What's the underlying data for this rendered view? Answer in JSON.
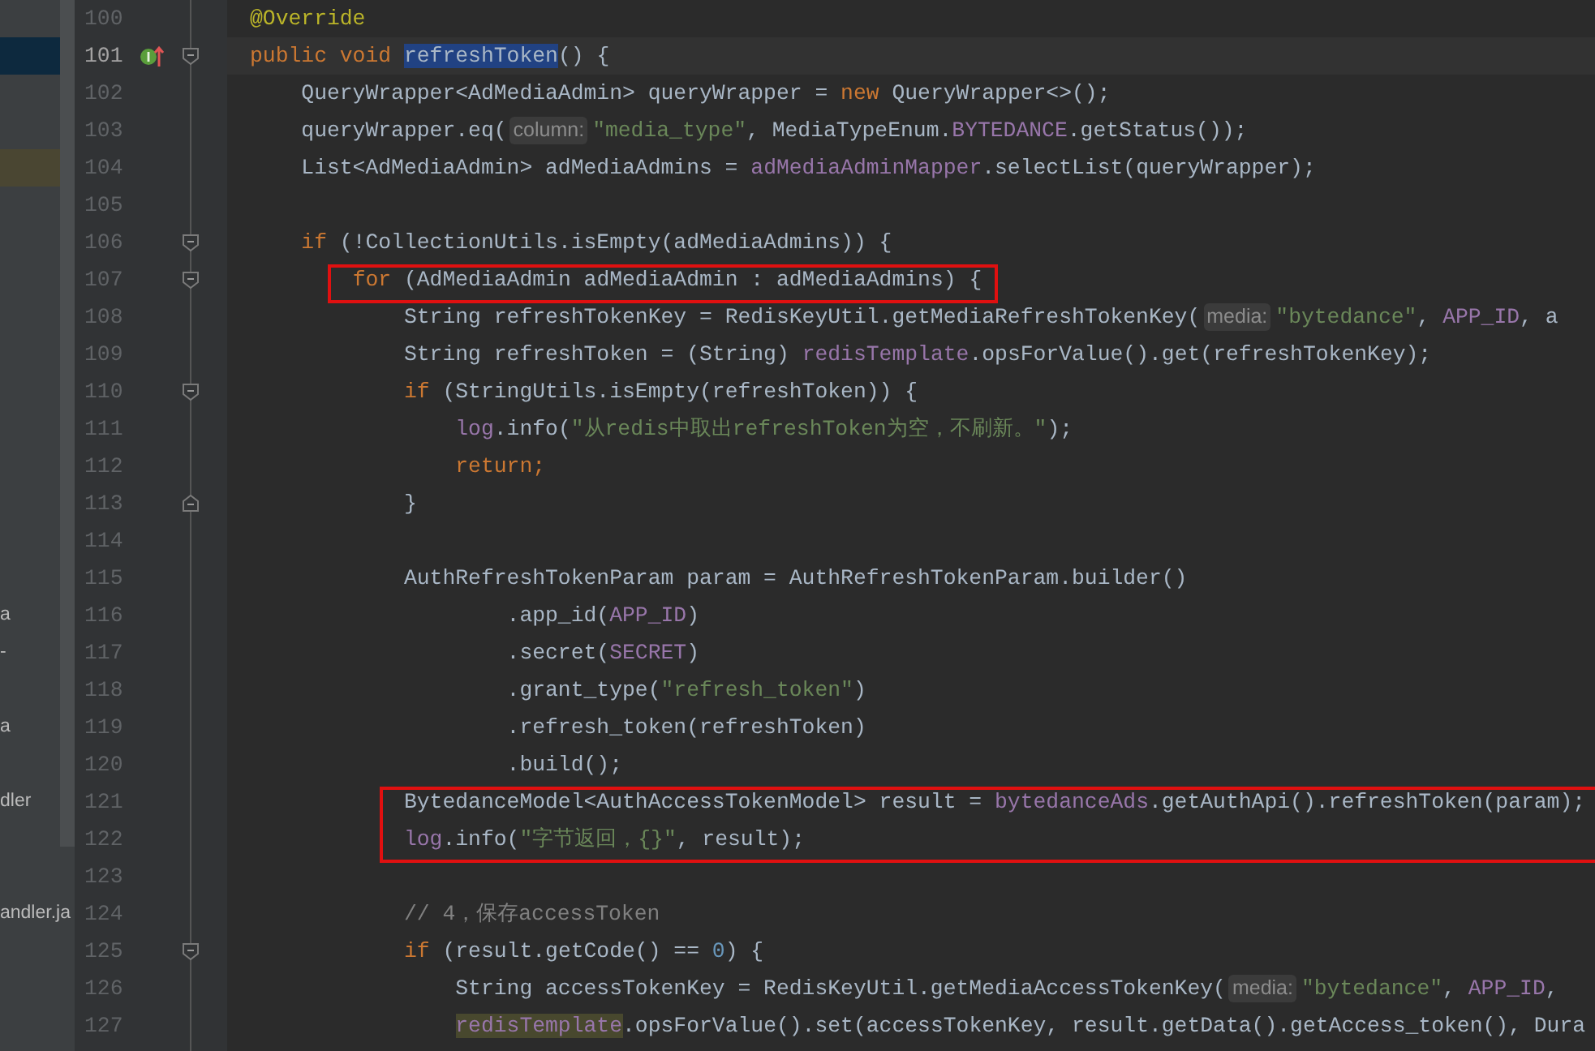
{
  "sidebar": {
    "rows": [
      {
        "selected": false
      },
      {
        "selected": true
      },
      {
        "selected": false
      },
      {
        "selected": false
      },
      {
        "selected": false,
        "highlighted": true
      },
      {
        "selected": false
      },
      {
        "selected": false
      },
      {
        "selected": false
      },
      {
        "selected": false
      },
      {
        "selected": false
      },
      {
        "selected": false
      },
      {
        "selected": false
      },
      {
        "selected": false
      },
      {
        "selected": false
      },
      {
        "selected": false
      },
      {
        "selected": false
      },
      {
        "selected": false,
        "text": "a"
      },
      {
        "selected": false,
        "text": "-"
      },
      {
        "selected": false
      },
      {
        "selected": false,
        "text": "a"
      },
      {
        "selected": false
      },
      {
        "selected": false,
        "text": "dler"
      },
      {
        "selected": false
      },
      {
        "selected": false
      },
      {
        "selected": false,
        "text": "andler.ja"
      }
    ]
  },
  "editor": {
    "lines": [
      {
        "number": "100",
        "boxed": false,
        "tokens": [
          {
            "kind": "annotation",
            "text": "@Override"
          }
        ]
      },
      {
        "number": "101",
        "current": true,
        "boxed": false,
        "fold_start": true,
        "override_marker": true,
        "tokens": [
          {
            "kind": "keyword",
            "text": "public void "
          },
          {
            "kind": "selection",
            "text": "refreshToken"
          },
          {
            "kind": "plain",
            "text": "() {"
          }
        ]
      },
      {
        "number": "102",
        "boxed": false,
        "tokens": [
          {
            "kind": "plain",
            "text": "    QueryWrapper<AdMediaAdmin> queryWrapper = "
          },
          {
            "kind": "keyword",
            "text": "new"
          },
          {
            "kind": "plain",
            "text": " QueryWrapper<>();"
          }
        ]
      },
      {
        "number": "103",
        "boxed": false,
        "tokens": [
          {
            "kind": "plain",
            "text": "    queryWrapper.eq("
          },
          {
            "kind": "hint",
            "text": "column:"
          },
          {
            "kind": "string",
            "text": "\"media_type\""
          },
          {
            "kind": "plain",
            "text": ", MediaTypeEnum."
          },
          {
            "kind": "field",
            "text": "BYTEDANCE"
          },
          {
            "kind": "plain",
            "text": ".getStatus());"
          }
        ]
      },
      {
        "number": "104",
        "boxed": false,
        "tokens": [
          {
            "kind": "plain",
            "text": "    List<AdMediaAdmin> adMediaAdmins = "
          },
          {
            "kind": "field",
            "text": "adMediaAdminMapper"
          },
          {
            "kind": "plain",
            "text": ".selectList(queryWrapper);"
          }
        ]
      },
      {
        "number": "105",
        "boxed": false
      },
      {
        "number": "106",
        "boxed": false,
        "fold_start": true,
        "tokens": [
          {
            "kind": "keyword",
            "text": "    if"
          },
          {
            "kind": "plain",
            "text": " (!CollectionUtils.isEmpty(adMediaAdmins)) {"
          }
        ]
      },
      {
        "number": "107",
        "boxed": true,
        "fold_start": true,
        "tokens": [
          {
            "kind": "keyword",
            "text": "        for"
          },
          {
            "kind": "plain",
            "text": " (AdMediaAdmin adMediaAdmin : adMediaAdmins) {"
          }
        ]
      },
      {
        "number": "108",
        "boxed": false,
        "tokens": [
          {
            "kind": "plain",
            "text": "            String refreshTokenKey = RedisKeyUtil.getMediaRefreshTokenKey("
          },
          {
            "kind": "hint",
            "text": "media:"
          },
          {
            "kind": "string",
            "text": "\"bytedance\""
          },
          {
            "kind": "plain",
            "text": ", "
          },
          {
            "kind": "field",
            "text": "APP_ID"
          },
          {
            "kind": "plain",
            "text": ", a"
          }
        ]
      },
      {
        "number": "109",
        "boxed": false,
        "tokens": [
          {
            "kind": "plain",
            "text": "            String refreshToken = (String) "
          },
          {
            "kind": "field",
            "text": "redisTemplate"
          },
          {
            "kind": "plain",
            "text": ".opsForValue().get(refreshTokenKey);"
          }
        ]
      },
      {
        "number": "110",
        "boxed": false,
        "fold_start": true,
        "tokens": [
          {
            "kind": "keyword",
            "text": "            if"
          },
          {
            "kind": "plain",
            "text": " (StringUtils.isEmpty(refreshToken)) {"
          }
        ]
      },
      {
        "number": "111",
        "boxed": false,
        "tokens": [
          {
            "kind": "field",
            "text": "                log"
          },
          {
            "kind": "plain",
            "text": ".info("
          },
          {
            "kind": "string",
            "text": "\"从redis中取出refreshToken为空，不刷新。\""
          },
          {
            "kind": "plain",
            "text": ");"
          }
        ]
      },
      {
        "number": "112",
        "boxed": false,
        "tokens": [
          {
            "kind": "keyword",
            "text": "                return;"
          }
        ]
      },
      {
        "number": "113",
        "boxed": false,
        "fold_end": true,
        "tokens": [
          {
            "kind": "plain",
            "text": "            }"
          }
        ]
      },
      {
        "number": "114",
        "boxed": false
      },
      {
        "number": "115",
        "boxed": false,
        "tokens": [
          {
            "kind": "plain",
            "text": "            AuthRefreshTokenParam param = AuthRefreshTokenParam.builder()"
          }
        ]
      },
      {
        "number": "116",
        "boxed": false,
        "tokens": [
          {
            "kind": "plain",
            "text": "                    .app_id("
          },
          {
            "kind": "field",
            "text": "APP_ID"
          },
          {
            "kind": "plain",
            "text": ")"
          }
        ]
      },
      {
        "number": "117",
        "boxed": false,
        "tokens": [
          {
            "kind": "plain",
            "text": "                    .secret("
          },
          {
            "kind": "field",
            "text": "SECRET"
          },
          {
            "kind": "plain",
            "text": ")"
          }
        ]
      },
      {
        "number": "118",
        "boxed": false,
        "tokens": [
          {
            "kind": "plain",
            "text": "                    .grant_type("
          },
          {
            "kind": "string",
            "text": "\"refresh_token\""
          },
          {
            "kind": "plain",
            "text": ")"
          }
        ]
      },
      {
        "number": "119",
        "boxed": false,
        "tokens": [
          {
            "kind": "plain",
            "text": "                    .refresh_token(refreshToken)"
          }
        ]
      },
      {
        "number": "120",
        "boxed": false,
        "tokens": [
          {
            "kind": "plain",
            "text": "                    .build();"
          }
        ]
      },
      {
        "number": "121",
        "boxed": true,
        "tokens": [
          {
            "kind": "plain",
            "text": "            BytedanceModel<AuthAccessTokenModel> result = "
          },
          {
            "kind": "field",
            "text": "bytedanceAds"
          },
          {
            "kind": "plain",
            "text": ".getAuthApi().refreshToken(param);"
          }
        ]
      },
      {
        "number": "122",
        "boxed": true,
        "tokens": [
          {
            "kind": "field",
            "text": "            log"
          },
          {
            "kind": "plain",
            "text": ".info("
          },
          {
            "kind": "string",
            "text": "\"字节返回，{}\""
          },
          {
            "kind": "plain",
            "text": ", result);"
          }
        ]
      },
      {
        "number": "123",
        "boxed": false
      },
      {
        "number": "124",
        "boxed": false,
        "tokens": [
          {
            "kind": "comment",
            "text": "            // 4，保存accessToken"
          }
        ]
      },
      {
        "number": "125",
        "boxed": false,
        "fold_start": true,
        "tokens": [
          {
            "kind": "keyword",
            "text": "            if"
          },
          {
            "kind": "plain",
            "text": " (result.getCode() == "
          },
          {
            "kind": "number",
            "text": "0"
          },
          {
            "kind": "plain",
            "text": ") {"
          }
        ]
      },
      {
        "number": "126",
        "boxed": false,
        "tokens": [
          {
            "kind": "plain",
            "text": "                String accessTokenKey = RedisKeyUtil.getMediaAccessTokenKey("
          },
          {
            "kind": "hint",
            "text": "media:"
          },
          {
            "kind": "string",
            "text": "\"bytedance\""
          },
          {
            "kind": "plain",
            "text": ", "
          },
          {
            "kind": "field",
            "text": "APP_ID"
          },
          {
            "kind": "plain",
            "text": ","
          }
        ]
      },
      {
        "number": "127",
        "boxed": false,
        "tokens": [
          {
            "kind": "field-highlight",
            "text": "                redisTemplate"
          },
          {
            "kind": "plain",
            "text": ".opsForValue().set(accessTokenKey, result.getData().getAccess_token(), Dura"
          }
        ]
      }
    ]
  }
}
